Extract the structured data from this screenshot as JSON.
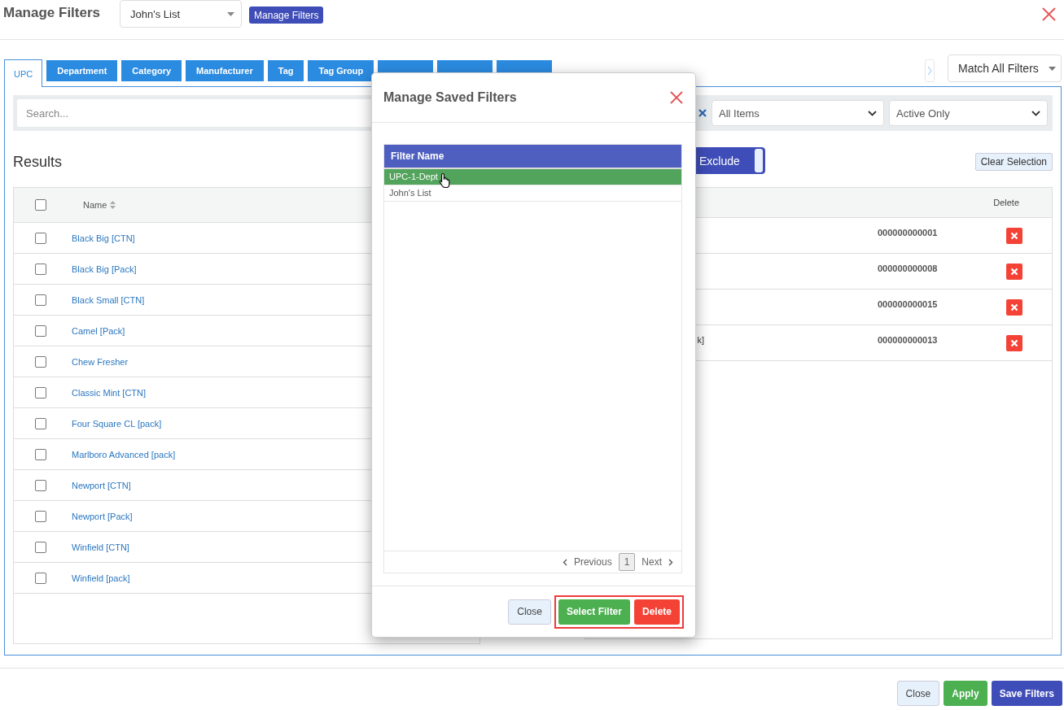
{
  "header": {
    "title": "Manage Filters",
    "saved_filter_select": "John's List",
    "manage_button": "Manage Filters"
  },
  "tabs": [
    {
      "label": "UPC",
      "selected": true
    },
    {
      "label": "Department",
      "selected": false
    },
    {
      "label": "Category",
      "selected": false
    },
    {
      "label": "Manufacturer",
      "selected": false
    },
    {
      "label": "Tag",
      "selected": false
    },
    {
      "label": "Tag Group",
      "selected": false
    },
    {
      "selected": false
    },
    {
      "selected": false
    },
    {
      "selected": false
    }
  ],
  "match_select": "Match All Filters",
  "filters": {
    "search_placeholder": "Search...",
    "items_select": "All Items",
    "status_select": "Active Only"
  },
  "results": {
    "title": "Results",
    "column": "Name",
    "select_all_checked": false,
    "rows": [
      {
        "name": "Black Big [CTN]",
        "checked": false
      },
      {
        "name": "Black Big [Pack]",
        "checked": false
      },
      {
        "name": "Black Small [CTN]",
        "checked": false
      },
      {
        "name": "Camel [Pack]",
        "checked": false
      },
      {
        "name": "Chew Fresher",
        "checked": false
      },
      {
        "name": "Classic Mint [CTN]",
        "checked": false
      },
      {
        "name": "Four Square CL [pack]",
        "checked": false
      },
      {
        "name": "Marlboro Advanced [pack]",
        "checked": false
      },
      {
        "name": "Newport [CTN]",
        "checked": false
      },
      {
        "name": "Newport [Pack]",
        "checked": false
      },
      {
        "name": "Winfield [CTN]",
        "checked": false
      },
      {
        "name": "Winfield [pack]",
        "checked": false
      }
    ]
  },
  "selection": {
    "toggle_label": "Exclude",
    "clear_button": "Clear Selection",
    "delete_column": "Delete",
    "rows": [
      {
        "upc": "000000000001"
      },
      {
        "upc": "000000000008"
      },
      {
        "upc": "000000000015"
      },
      {
        "name": "k]",
        "upc": "000000000013"
      }
    ]
  },
  "modal": {
    "title": "Manage Saved Filters",
    "column": "Filter Name",
    "rows": [
      {
        "name": "UPC-1-Dept",
        "selected": true
      },
      {
        "name": "John's List",
        "selected": false
      }
    ],
    "pagination": {
      "previous": "Previous",
      "page": "1",
      "next": "Next"
    },
    "buttons": [
      {
        "label": "Close",
        "kind": "secondary"
      },
      {
        "label": "Select Filter",
        "kind": "success"
      },
      {
        "label": "Delete",
        "kind": "danger"
      }
    ]
  },
  "footer_buttons": [
    {
      "label": "Close",
      "kind": "secondary"
    },
    {
      "label": "Apply",
      "kind": "success"
    },
    {
      "label": "Save Filters",
      "kind": "primary"
    }
  ]
}
